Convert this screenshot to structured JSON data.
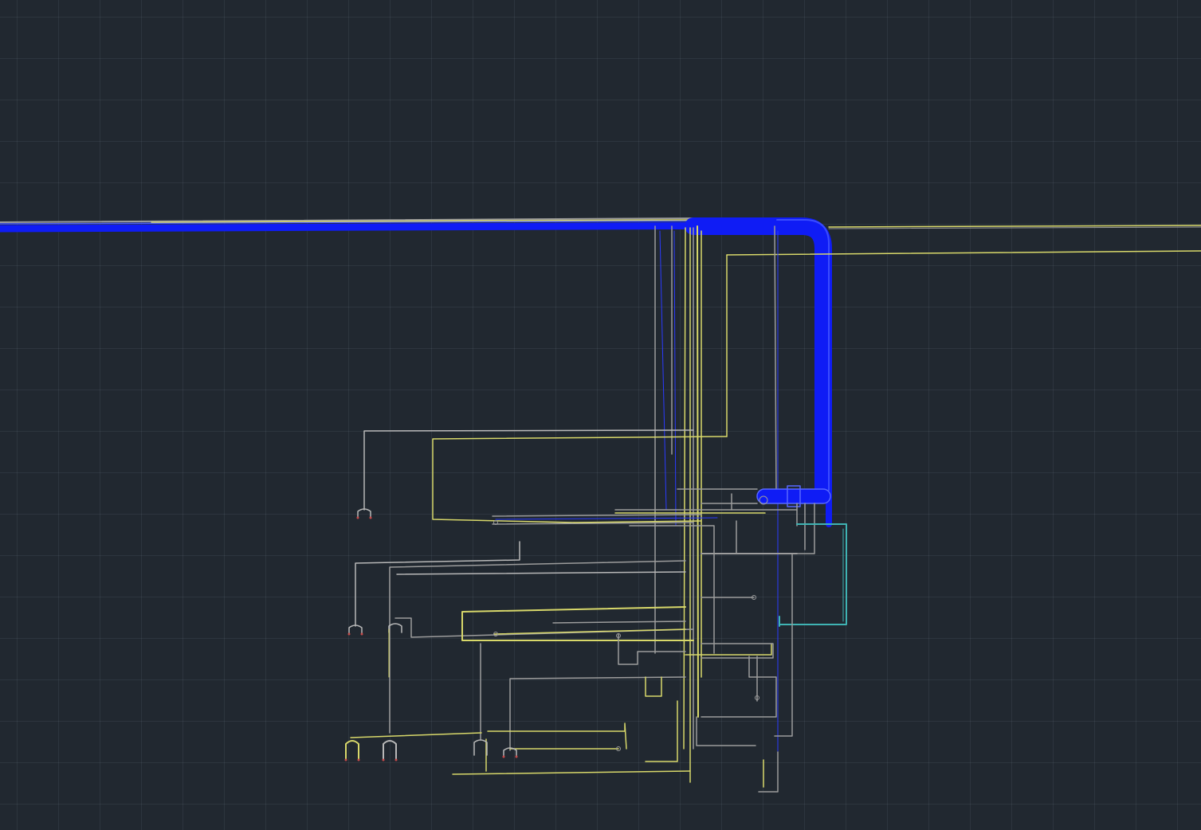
{
  "application": "cad-model-space",
  "theme": {
    "background": "#212830",
    "grid_line": "#3a434e"
  },
  "layers": [
    {
      "name": "main-pipe",
      "color": "#0f1cf5"
    },
    {
      "name": "yellow-pipe",
      "color": "#d8d86a"
    },
    {
      "name": "gray-pipe",
      "color": "#9c9c9c"
    },
    {
      "name": "cyan-pipe",
      "color": "#3fb3b3"
    },
    {
      "name": "light-gray-pipe",
      "color": "#b8b8b8"
    }
  ]
}
